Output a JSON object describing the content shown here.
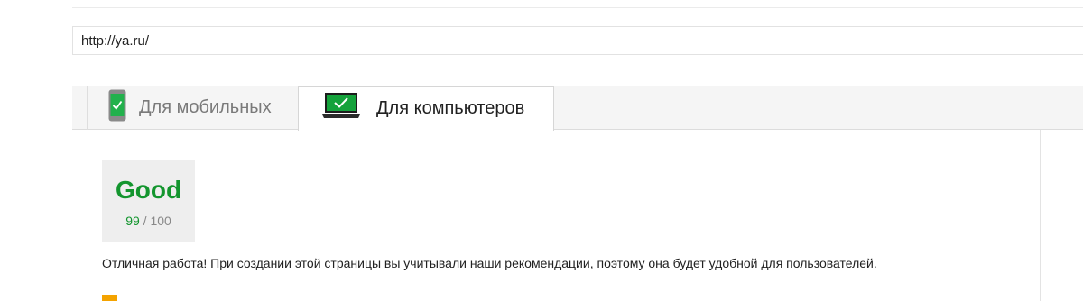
{
  "url_input": {
    "value": "http://ya.ru/"
  },
  "tabs": [
    {
      "label": "Для мобильных",
      "icon": "phone-check-icon",
      "active": false
    },
    {
      "label": "Для компьютеров",
      "icon": "laptop-check-icon",
      "active": true
    }
  ],
  "result": {
    "rating": "Good",
    "score": "99",
    "separator": "/",
    "max": "100",
    "summary": "Отличная работа! При создании этой страницы вы учитывали наши рекомендации, поэтому она будет удобной для пользователей."
  },
  "colors": {
    "good": "#13952e",
    "warning_marker": "#f4a300",
    "accent_laptop": "#0f9d58"
  }
}
